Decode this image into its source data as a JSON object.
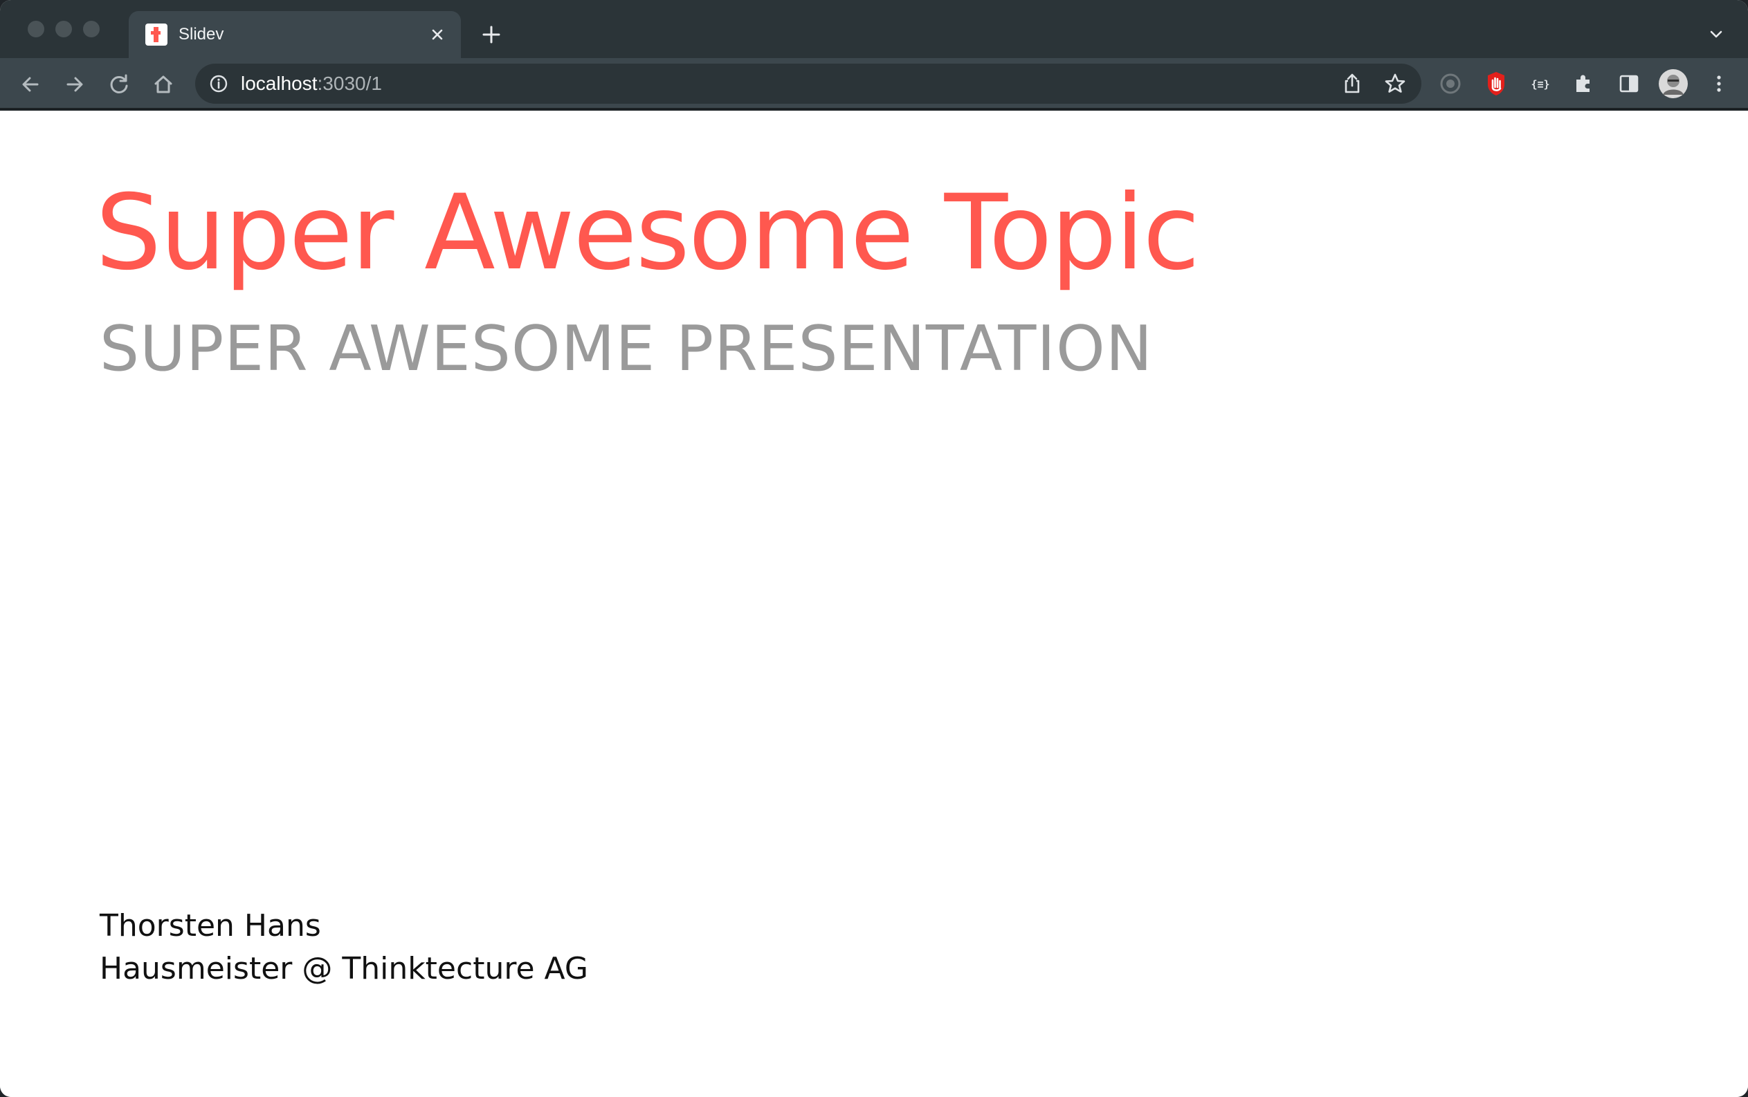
{
  "browser": {
    "tab": {
      "title": "Slidev",
      "favicon": "thinktecture-t-icon"
    },
    "address": {
      "host": "localhost",
      "rest": ":3030/1"
    },
    "icons": {
      "back": "back-arrow-icon",
      "forward": "forward-arrow-icon",
      "reload": "reload-icon",
      "home": "home-icon",
      "share": "share-icon",
      "bookmark": "star-icon",
      "extensions": "puzzle-icon",
      "side_panel": "side-panel-icon",
      "menu": "kebab-menu-icon"
    }
  },
  "slide": {
    "title": "Super Awesome Topic",
    "subtitle": "SUPER AWESOME PRESENTATION",
    "author_name": "Thorsten Hans",
    "author_role": "Hausmeister @ Thinktecture AG"
  },
  "colors": {
    "accent": "#ff584f",
    "subtitle": "#9a9a9a",
    "chrome_dark": "#2b3438",
    "chrome_toolbar": "#3c474d"
  }
}
